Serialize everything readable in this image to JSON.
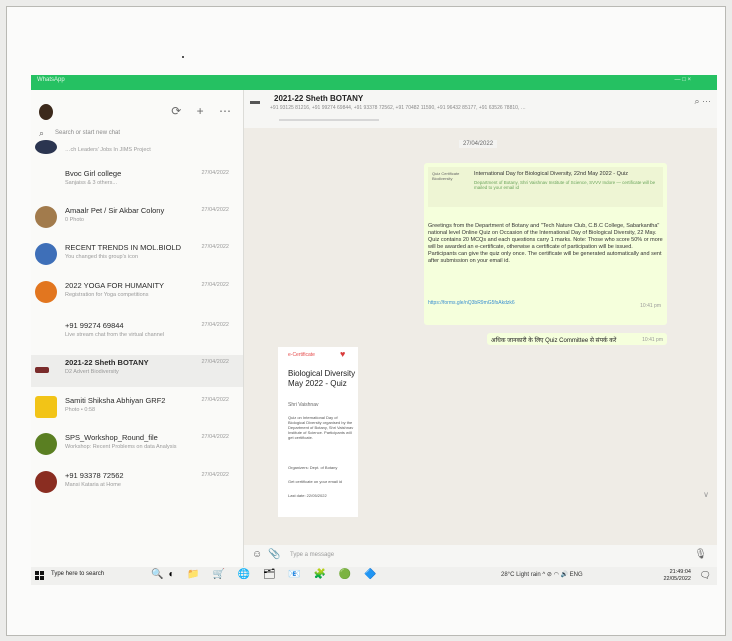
{
  "app": {
    "title": "WhatsApp",
    "right": "—  □  ×"
  },
  "sidebar": {
    "icons": "⟳  +  ⋯",
    "search_placeholder": "Search or start new chat",
    "chats": [
      {
        "name": "",
        "preview": "…ch Leaders' Jobs In JIMS Project",
        "time": ""
      },
      {
        "name": "Bvoc Girl college",
        "preview": "Sanjaiss & 3 others...",
        "time": "27/04/2022"
      },
      {
        "name": "Amaalr Pet / Sir Akbar Colony",
        "preview": "0 Photo",
        "time": "27/04/2022"
      },
      {
        "name": "RECENT TRENDS IN MOL.BIOLD",
        "preview": "You changed this group's icon",
        "time": "27/04/2022"
      },
      {
        "name": "2022 YOGA FOR HUMANITY",
        "preview": "Registration for Yoga competitions",
        "time": "27/04/2022"
      },
      {
        "name": "+91 99274 69844",
        "preview": "Live stream chat from the virtual channel",
        "time": "27/04/2022"
      },
      {
        "name": "2021-22 Sheth BOTANY",
        "preview": "D2 Advert Biodiversity",
        "time": "27/04/2022"
      },
      {
        "name": "Samiti Shiksha Abhiyan GRF2",
        "preview": "Photo • 0:58",
        "time": "27/04/2022"
      },
      {
        "name": "SPS_Workshop_Round_file",
        "preview": "Workshop: Recent Problems on data Analysis",
        "time": "27/04/2022"
      },
      {
        "name": "+91 93378 72562",
        "preview": "Mansi Kataria at Home",
        "time": "27/04/2022"
      }
    ]
  },
  "chat_header": {
    "title": "2021-22 Sheth BOTANY",
    "subtitle": "+91 93125 81216, +91 99274 69844, +91 93378 72562, +91 70482 11590, +91 96432 85177, +91 63526 78810, …",
    "icons": "⌕  ⋯"
  },
  "messages": {
    "date": "27/04/2022",
    "link_preview": {
      "thumb": "Quiz Certificate Biodiversity",
      "title": "International Day for Biological Diversity, 22nd May 2022 - Quiz",
      "desc": "Department of Botany, Shri Vaishnav Institute of Science, SVVV Indore — certificate will be mailed to your email id"
    },
    "body": "Greetings from the Department of Botany and \"Tech Nature Club, C.B.C College, Sabarkantha\" national level Online Quiz on Occasion of the International Day of Biological Diversity, 22 May. Quiz contains 20 MCQs and each questions carry 1 marks. Note: Those who score 50% or more will be awarded an e-certificate, otherwise a certificate of participation will be issued. Participants can give the quiz only once. The certificate will be generated automatically and sent after submission on your email id.",
    "link": "https://forms.gle/nQ3bR9mG5fsAkdzk6",
    "time": "10:41 pm",
    "b2_text": "अधिक जानकारी के लिए Quiz Committee से संपर्क करें",
    "b2_time": "10:41 pm",
    "poster": {
      "tag": "e-Certificate",
      "heading": "Biological Diversity May 2022 - Quiz",
      "by": "Shri Vaishnav",
      "text": "Quiz on International Day of Biological Diversity organised by the Department of Botany, Shri Vaishnav Institute of Science. Participants will get certificate.",
      "row1": "Organizers: Dept. of Botany",
      "row2": "Get certificate on your email id",
      "row3": "Last date: 22/05/2022"
    }
  },
  "composer": {
    "placeholder": "Type a message",
    "emoji": "☺",
    "attach": "📎",
    "mic": "🎙"
  },
  "taskbar": {
    "search": "Type here to search",
    "apps": "🔍◐ 📁 🛒 🌐 🗂 📧 🧩 🟢 🔷",
    "tray": "28°C Light rain  ^ ⊘ ◠ 🔊 ENG",
    "clock_time": "21:49:04",
    "clock_date": "22/05/2022",
    "notification": "🗨"
  }
}
